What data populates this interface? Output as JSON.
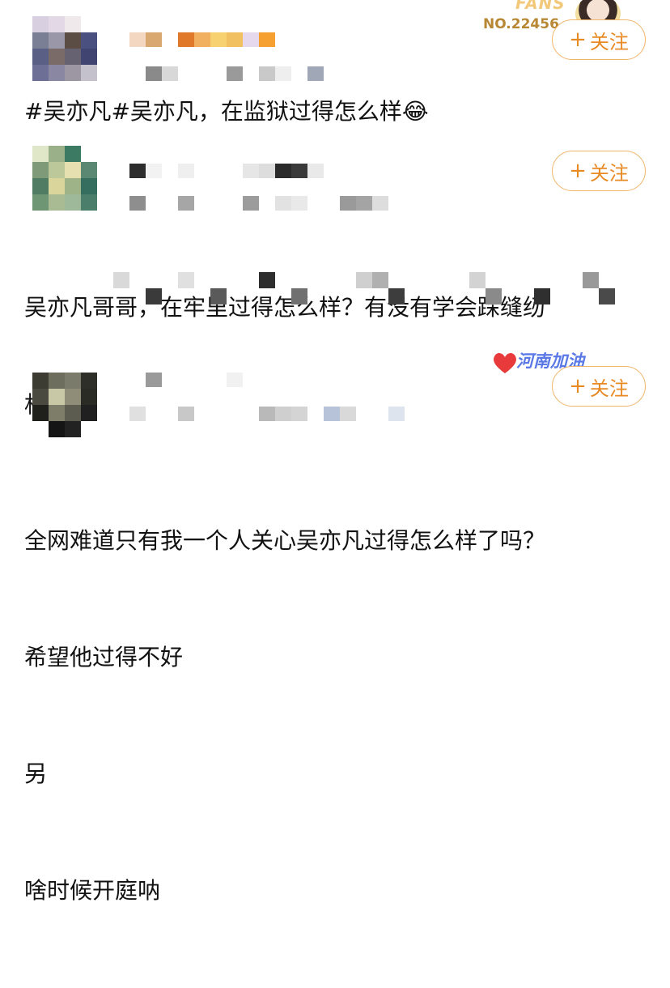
{
  "badges": {
    "fans_word": "FANS",
    "fans_number": "NO.22456",
    "henan_text": "河南加油"
  },
  "posts": [
    {
      "follow_label": "关注",
      "content_lines": [
        "#吴亦凡#吴亦凡，在监狱过得怎么样😂"
      ]
    },
    {
      "follow_label": "关注",
      "content_lines": [
        "吴亦凡哥哥，在牢里过得怎么样？有没有学会踩缝纫",
        "机？🥺"
      ]
    },
    {
      "follow_label": "关注",
      "content_lines": [
        "全网难道只有我一个人关心吴亦凡过得怎么样了吗？",
        "希望他过得不好",
        "另",
        "啥时候开庭呐"
      ]
    }
  ],
  "colors": {
    "follow_border": "#f0b56c",
    "follow_text": "#e88a24"
  },
  "icons": {
    "follow_plus": "plus-icon",
    "laughing_emoji": "face-with-tears-of-joy-icon",
    "pleading_emoji": "pleading-face-icon",
    "heart": "heart-icon"
  }
}
